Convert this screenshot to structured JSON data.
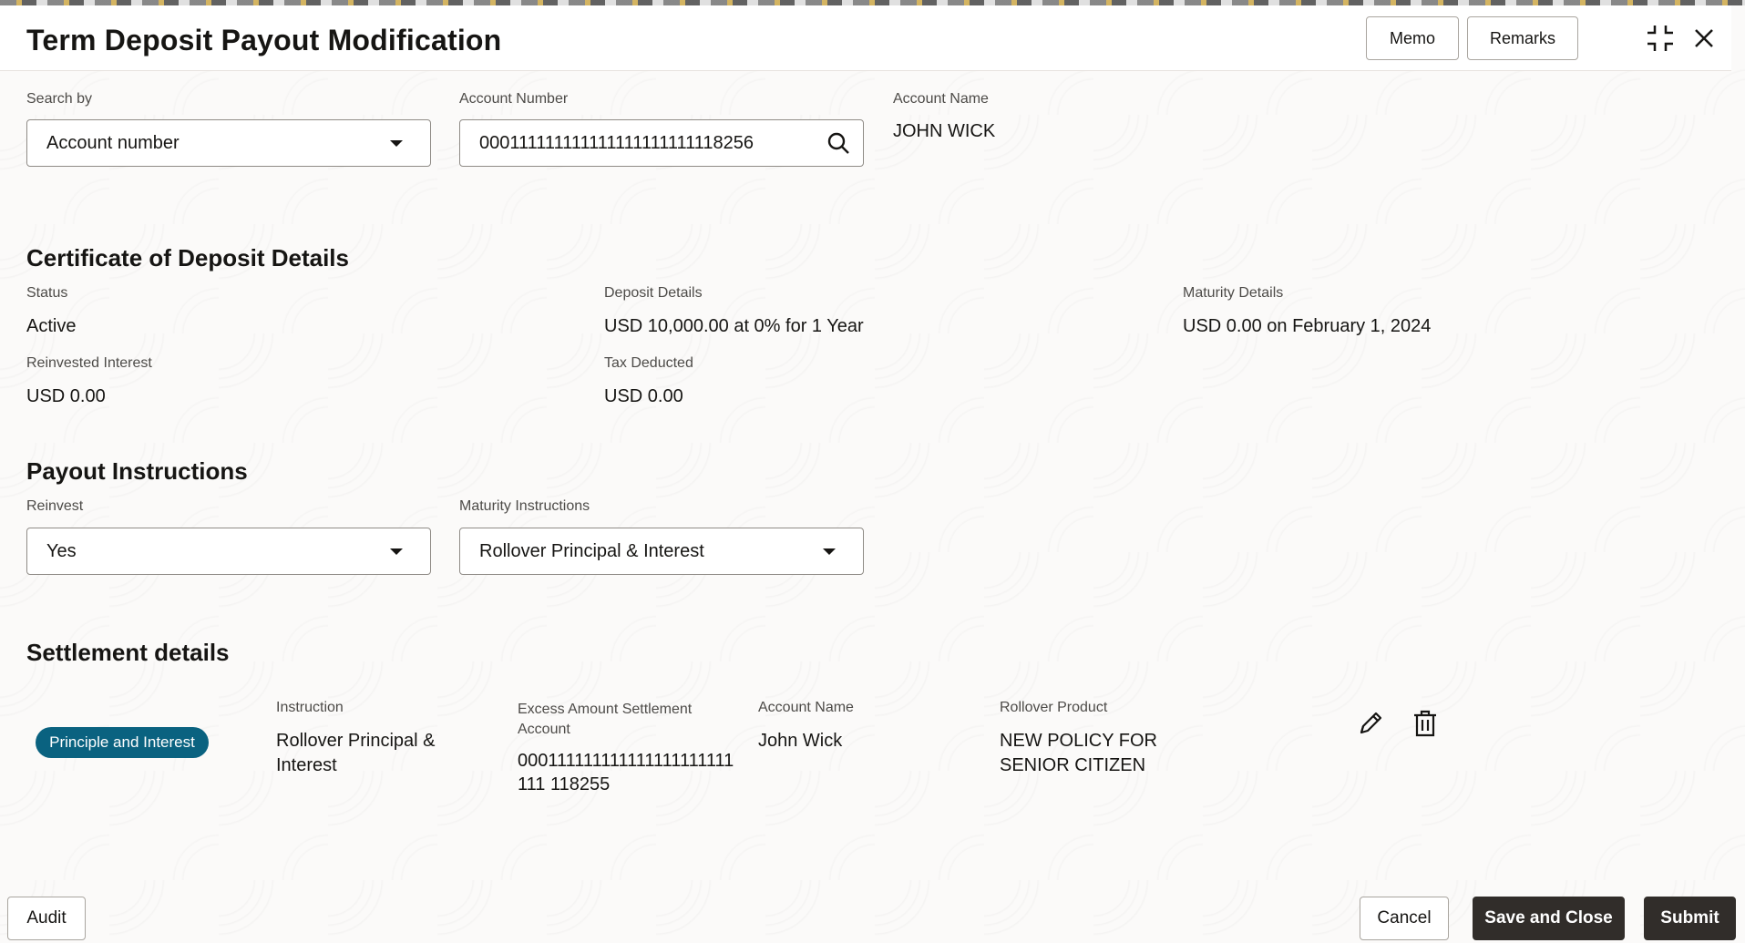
{
  "header": {
    "title": "Term Deposit Payout Modification",
    "memo_label": "Memo",
    "remarks_label": "Remarks"
  },
  "search": {
    "search_by_label": "Search by",
    "search_by_value": "Account number",
    "account_number_label": "Account Number",
    "account_number_value": "000111111111111111111111118256",
    "account_name_label": "Account Name",
    "account_name_value": "JOHN WICK"
  },
  "cd_details": {
    "title": "Certificate of Deposit Details",
    "status_label": "Status",
    "status_value": "Active",
    "deposit_label": "Deposit Details",
    "deposit_value": "USD 10,000.00 at 0% for 1 Year",
    "maturity_label": "Maturity Details",
    "maturity_value": "USD 0.00 on February 1, 2024",
    "reinvested_label": "Reinvested Interest",
    "reinvested_value": "USD 0.00",
    "tax_label": "Tax Deducted",
    "tax_value": "USD 0.00"
  },
  "payout": {
    "title": "Payout Instructions",
    "reinvest_label": "Reinvest",
    "reinvest_value": "Yes",
    "maturity_instr_label": "Maturity Instructions",
    "maturity_instr_value": "Rollover Principal & Interest"
  },
  "settlement": {
    "title": "Settlement details",
    "badge": "Principle and Interest",
    "instruction_label": "Instruction",
    "instruction_value": "Rollover Principal & Interest",
    "excess_label": "Excess Amount Settlement Account",
    "excess_value": "000111111111111111111111111 118255",
    "account_name_label": "Account Name",
    "account_name_value": "John Wick",
    "rollover_label": "Rollover Product",
    "rollover_value": "NEW POLICY FOR SENIOR CITIZEN"
  },
  "footer": {
    "audit_label": "Audit",
    "cancel_label": "Cancel",
    "save_close_label": "Save and Close",
    "submit_label": "Submit"
  },
  "colors": {
    "badge": "#0a6280",
    "primary_button": "#312d2a"
  }
}
